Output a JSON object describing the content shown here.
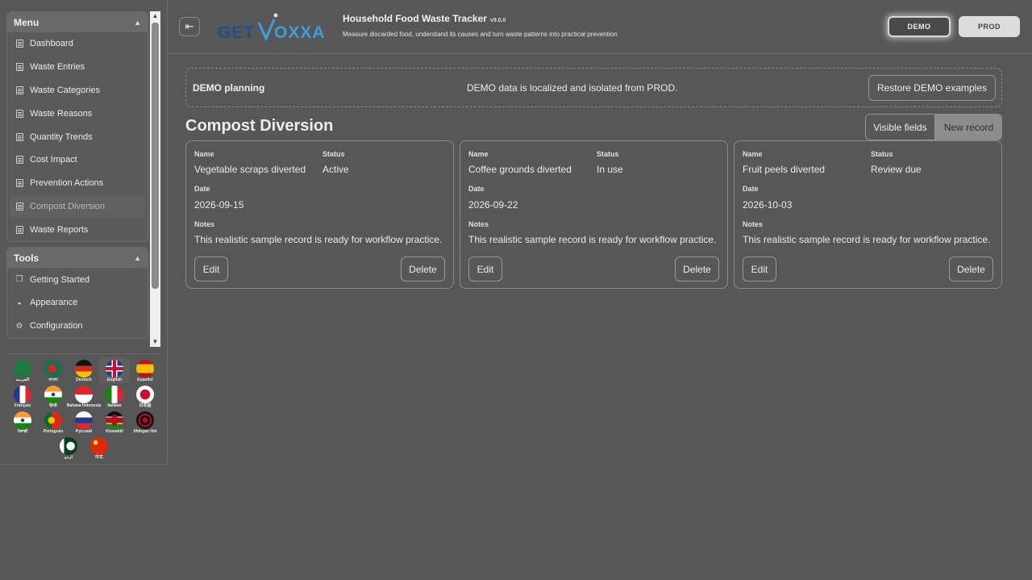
{
  "sidebar": {
    "menu_title": "Menu",
    "tools_title": "Tools",
    "menu_items": [
      {
        "label": "Dashboard"
      },
      {
        "label": "Waste Entries"
      },
      {
        "label": "Waste Categories"
      },
      {
        "label": "Waste Reasons"
      },
      {
        "label": "Quantity Trends"
      },
      {
        "label": "Cost Impact"
      },
      {
        "label": "Prevention Actions"
      },
      {
        "label": "Compost Diversion",
        "active": true
      },
      {
        "label": "Waste Reports"
      }
    ],
    "tool_items": [
      {
        "label": "Getting Started",
        "icon": "flag-start-icon"
      },
      {
        "label": "Appearance",
        "icon": "palette-icon"
      },
      {
        "label": "Configuration",
        "icon": "gear-icon"
      }
    ],
    "languages": [
      {
        "label": "العربية",
        "flag": "saudi-arabia"
      },
      {
        "label": "বাংলা",
        "flag": "bangladesh"
      },
      {
        "label": "Deutsch",
        "flag": "germany"
      },
      {
        "label": "English",
        "flag": "united-kingdom",
        "selected": true
      },
      {
        "label": "Español",
        "flag": "spain"
      },
      {
        "label": "Français",
        "flag": "france"
      },
      {
        "label": "हिन्दी",
        "flag": "india"
      },
      {
        "label": "Bahasa Indonesia",
        "flag": "indonesia"
      },
      {
        "label": "Italiano",
        "flag": "italy"
      },
      {
        "label": "日本語",
        "flag": "japan"
      },
      {
        "label": "ਪੰਜਾਬੀ",
        "flag": "india-punjabi"
      },
      {
        "label": "Português",
        "flag": "portugal"
      },
      {
        "label": "Русский",
        "flag": "russia"
      },
      {
        "label": "Kiswahili",
        "flag": "kenya"
      },
      {
        "label": "tlhIngan Hol",
        "flag": "klingon"
      },
      {
        "label": "اردو",
        "flag": "pakistan"
      },
      {
        "label": "中文",
        "flag": "china"
      }
    ]
  },
  "header": {
    "logo_text": "GETVOXXA",
    "title": "Household Food Waste Tracker",
    "version": "v9.0.0",
    "subtitle": "Measure discarded food, understand its causes and turn waste patterns into practical prevention",
    "demo_label": "DEMO",
    "prod_label": "PROD"
  },
  "banner": {
    "title": "DEMO planning",
    "text": "DEMO data is localized and isolated from PROD.",
    "restore_label": "Restore DEMO examples"
  },
  "main": {
    "section_title": "Compost Diversion",
    "visible_fields_label": "Visible fields",
    "new_record_label": "New record",
    "labels": {
      "name": "Name",
      "status": "Status",
      "date": "Date",
      "notes": "Notes",
      "edit": "Edit",
      "delete": "Delete"
    },
    "records": [
      {
        "name": "Vegetable scraps diverted",
        "status": "Active",
        "date": "2026-09-15",
        "notes": "This realistic sample record is ready for workflow practice."
      },
      {
        "name": "Coffee grounds diverted",
        "status": "In use",
        "date": "2026-09-22",
        "notes": "This realistic sample record is ready for workflow practice."
      },
      {
        "name": "Fruit peels diverted",
        "status": "Review due",
        "date": "2026-10-03",
        "notes": "This realistic sample record is ready for workflow practice."
      }
    ]
  },
  "colors": {
    "background": "#575757",
    "accent": "#3aa0d8",
    "logo_blue": "#1f4f8a"
  }
}
